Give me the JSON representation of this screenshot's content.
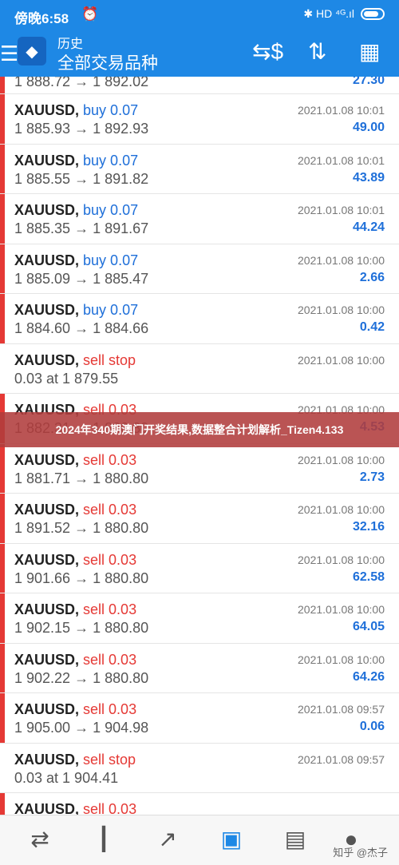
{
  "status": {
    "time": "傍晚6:58",
    "alarm_icon": "alarm-icon",
    "indicators": "✱ HD ⁴ᴳ.ıl"
  },
  "header": {
    "subtitle": "历史",
    "title": "全部交易品种",
    "menu_icon": "menu-icon",
    "logo_icon": "metatrader-logo-icon",
    "actions": [
      "currency-swap-icon",
      "sort-icon",
      "calendar-icon"
    ]
  },
  "partial_row": {
    "prices": "1 888.72 → 1 892.02",
    "profit": "27.30"
  },
  "rows": [
    {
      "symbol": "XAUUSD,",
      "side": "buy 0.07",
      "type": "buy",
      "prices": "1 885.93 → 1 892.93",
      "date": "2021.01.08 10:01",
      "profit": "49.00"
    },
    {
      "symbol": "XAUUSD,",
      "side": "buy 0.07",
      "type": "buy",
      "prices": "1 885.55 → 1 891.82",
      "date": "2021.01.08 10:01",
      "profit": "43.89"
    },
    {
      "symbol": "XAUUSD,",
      "side": "buy 0.07",
      "type": "buy",
      "prices": "1 885.35 → 1 891.67",
      "date": "2021.01.08 10:01",
      "profit": "44.24"
    },
    {
      "symbol": "XAUUSD,",
      "side": "buy 0.07",
      "type": "buy",
      "prices": "1 885.09 → 1 885.47",
      "date": "2021.01.08 10:00",
      "profit": "2.66"
    },
    {
      "symbol": "XAUUSD,",
      "side": "buy 0.07",
      "type": "buy",
      "prices": "1 884.60 → 1 884.66",
      "date": "2021.01.08 10:00",
      "profit": "0.42"
    },
    {
      "symbol": "XAUUSD,",
      "side": "sell stop",
      "type": "sell",
      "prices": "0.03 at 1 879.55",
      "date": "2021.01.08 10:00",
      "profit": ""
    },
    {
      "symbol": "XAUUSD,",
      "side": "sell 0.03",
      "type": "sell",
      "prices": "1 882.31 → 1 880.80",
      "date": "2021.01.08 10:00",
      "profit": "4.53"
    },
    {
      "symbol": "XAUUSD,",
      "side": "sell 0.03",
      "type": "sell",
      "prices": "1 881.71 → 1 880.80",
      "date": "2021.01.08 10:00",
      "profit": "2.73"
    },
    {
      "symbol": "XAUUSD,",
      "side": "sell 0.03",
      "type": "sell",
      "prices": "1 891.52 → 1 880.80",
      "date": "2021.01.08 10:00",
      "profit": "32.16"
    },
    {
      "symbol": "XAUUSD,",
      "side": "sell 0.03",
      "type": "sell",
      "prices": "1 901.66 → 1 880.80",
      "date": "2021.01.08 10:00",
      "profit": "62.58"
    },
    {
      "symbol": "XAUUSD,",
      "side": "sell 0.03",
      "type": "sell",
      "prices": "1 902.15 → 1 880.80",
      "date": "2021.01.08 10:00",
      "profit": "64.05"
    },
    {
      "symbol": "XAUUSD,",
      "side": "sell 0.03",
      "type": "sell",
      "prices": "1 902.22 → 1 880.80",
      "date": "2021.01.08 10:00",
      "profit": "64.26"
    },
    {
      "symbol": "XAUUSD,",
      "side": "sell 0.03",
      "type": "sell",
      "prices": "1 905.00 → 1 904.98",
      "date": "2021.01.08 09:57",
      "profit": "0.06"
    },
    {
      "symbol": "XAUUSD,",
      "side": "sell stop",
      "type": "sell",
      "prices": "0.03 at 1 904.41",
      "date": "2021.01.08 09:57",
      "profit": ""
    },
    {
      "symbol": "XAUUSD,",
      "side": "sell 0.03",
      "type": "sell",
      "prices": "",
      "date": "",
      "profit": ""
    }
  ],
  "banner": "2024年340期澳门开奖结果,数据整合计划解析_Tizen4.133",
  "bottom_nav": [
    {
      "name": "quotes-icon",
      "glyph": "⇄"
    },
    {
      "name": "chart-icon",
      "glyph": "┃"
    },
    {
      "name": "trade-icon",
      "glyph": "↗"
    },
    {
      "name": "history-icon",
      "glyph": "▣"
    },
    {
      "name": "journal-icon",
      "glyph": "▤"
    },
    {
      "name": "messages-icon",
      "glyph": "●"
    }
  ],
  "watermark": "知乎 @杰子",
  "colors": {
    "accent": "#1e88e5",
    "buy": "#1e6fd9",
    "sell": "#e53935",
    "profit": "#1e6fd9"
  }
}
